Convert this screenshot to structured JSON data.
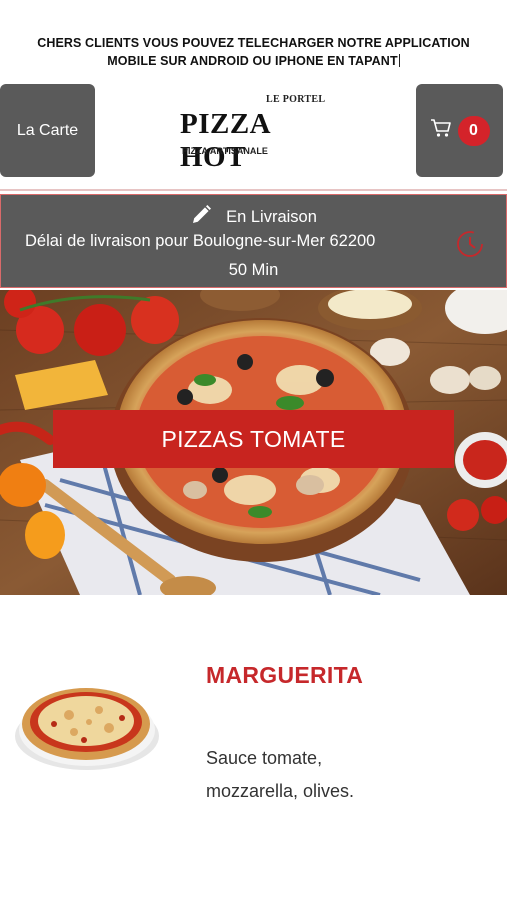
{
  "notice": {
    "line1": "CHERS CLIENTS VOUS POUVEZ TELECHARGER NOTRE APPLICATION",
    "line2": "MOBILE SUR ANDROID OU IPHONE EN TAPANT"
  },
  "header": {
    "menu_label": "La Carte",
    "cart_count": "0",
    "logo": {
      "top": "LE PORTEL",
      "main": "PIZZA HOT",
      "sub": "PIZZA ARTISANALE"
    }
  },
  "delivery": {
    "mode": "En Livraison",
    "info": "Délai de livraison pour Boulogne-sur-Mer 62200",
    "time": "50 Min"
  },
  "hero": {
    "banner": "PIZZAS TOMATE"
  },
  "product": {
    "name": "MARGUERITA",
    "description": "Sauce tomate, mozzarella, olives."
  },
  "colors": {
    "accent": "#c8241f",
    "panel": "#5a5a5a",
    "badge": "#d4232a"
  }
}
